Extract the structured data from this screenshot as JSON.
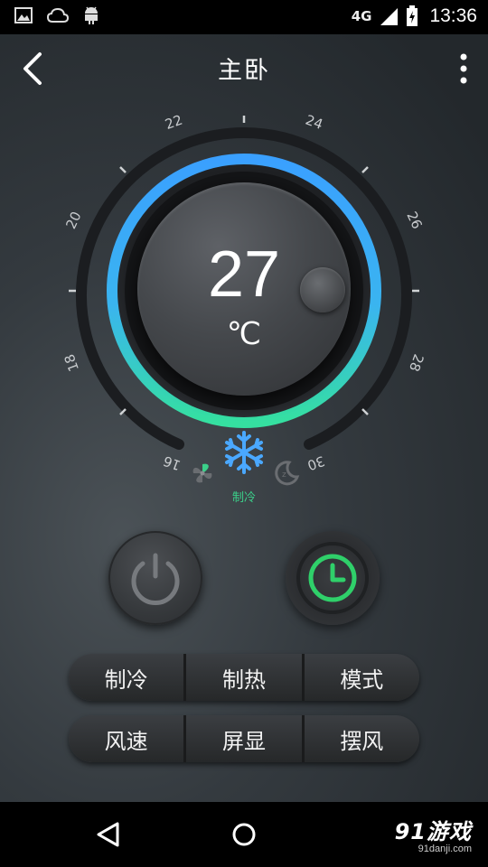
{
  "status_bar": {
    "network": "4G",
    "time": "13:36",
    "icons": [
      "image-icon",
      "cloud-icon",
      "android-icon",
      "signal-icon",
      "battery-charging-icon"
    ]
  },
  "header": {
    "title": "主卧",
    "back_icon": "chevron-left-icon",
    "menu_icon": "more-vertical-icon"
  },
  "dial": {
    "temperature": "27",
    "unit": "℃",
    "scale_labels": [
      "16",
      "18",
      "20",
      "22",
      "24",
      "26",
      "28",
      "30"
    ],
    "mode_label": "制冷",
    "mode_icons": [
      "fan-icon",
      "snowflake-icon",
      "sleep-moon-icon"
    ],
    "colors": {
      "arc_start": "#3aa0ff",
      "arc_end": "#35e0a0",
      "active_mode": "#3bd08a",
      "snowflake": "#4aa8ff"
    }
  },
  "controls": {
    "power_icon": "power-icon",
    "timer_icon": "clock-icon",
    "timer_color": "#2fd06a"
  },
  "buttons": {
    "row1": [
      "制冷",
      "制热",
      "模式"
    ],
    "row2": [
      "风速",
      "屏显",
      "摆风"
    ]
  },
  "nav": {
    "icons": [
      "nav-back-icon",
      "nav-home-icon"
    ],
    "watermark_main": "91游戏",
    "watermark_sub": "91danji.com"
  }
}
